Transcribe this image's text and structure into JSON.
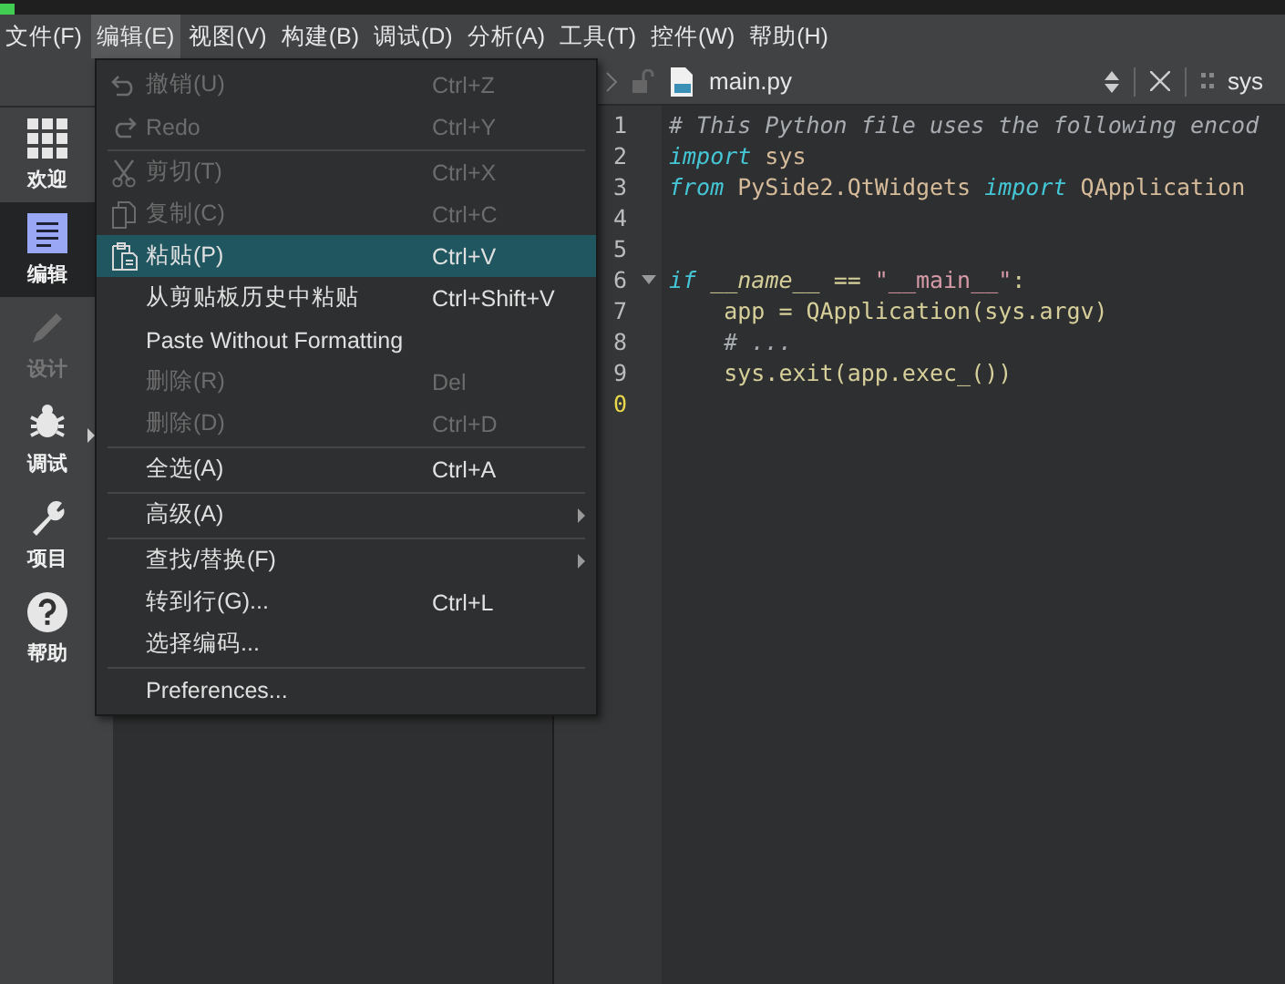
{
  "menubar": [
    {
      "label": "文件(F)",
      "selected": false
    },
    {
      "label": "编辑(E)",
      "selected": true
    },
    {
      "label": "视图(V)",
      "selected": false
    },
    {
      "label": "构建(B)",
      "selected": false
    },
    {
      "label": "调试(D)",
      "selected": false
    },
    {
      "label": "分析(A)",
      "selected": false
    },
    {
      "label": "工具(T)",
      "selected": false
    },
    {
      "label": "控件(W)",
      "selected": false
    },
    {
      "label": "帮助(H)",
      "selected": false
    }
  ],
  "modes": [
    {
      "label": "欢迎",
      "selected": false,
      "disabled": false,
      "has_arrow": false
    },
    {
      "label": "编辑",
      "selected": true,
      "disabled": false,
      "has_arrow": false
    },
    {
      "label": "设计",
      "selected": false,
      "disabled": true,
      "has_arrow": false
    },
    {
      "label": "调试",
      "selected": false,
      "disabled": false,
      "has_arrow": true
    },
    {
      "label": "项目",
      "selected": false,
      "disabled": false,
      "has_arrow": false
    },
    {
      "label": "帮助",
      "selected": false,
      "disabled": false,
      "has_arrow": false
    }
  ],
  "edit_menu": [
    {
      "kind": "item",
      "label": "撤销(U)",
      "shortcut": "Ctrl+Z",
      "disabled": true,
      "selected": false,
      "submenu": false
    },
    {
      "kind": "item",
      "label": "Redo",
      "shortcut": "Ctrl+Y",
      "disabled": true,
      "selected": false,
      "submenu": false
    },
    {
      "kind": "separator"
    },
    {
      "kind": "item",
      "label": "剪切(T)",
      "shortcut": "Ctrl+X",
      "disabled": true,
      "selected": false,
      "submenu": false
    },
    {
      "kind": "item",
      "label": "复制(C)",
      "shortcut": "Ctrl+C",
      "disabled": true,
      "selected": false,
      "submenu": false
    },
    {
      "kind": "item",
      "label": "粘贴(P)",
      "shortcut": "Ctrl+V",
      "disabled": false,
      "selected": true,
      "submenu": false
    },
    {
      "kind": "item",
      "label": "从剪贴板历史中粘贴",
      "shortcut": "Ctrl+Shift+V",
      "disabled": false,
      "selected": false,
      "submenu": false
    },
    {
      "kind": "item",
      "label": "Paste Without Formatting",
      "disabled": false,
      "selected": false,
      "submenu": false
    },
    {
      "kind": "item",
      "label": "删除(R)",
      "shortcut": "Del",
      "disabled": true,
      "selected": false,
      "submenu": false
    },
    {
      "kind": "item",
      "label": "删除(D)",
      "shortcut": "Ctrl+D",
      "disabled": true,
      "selected": false,
      "submenu": false
    },
    {
      "kind": "separator"
    },
    {
      "kind": "item",
      "label": "全选(A)",
      "shortcut": "Ctrl+A",
      "disabled": false,
      "selected": false,
      "submenu": false
    },
    {
      "kind": "separator"
    },
    {
      "kind": "item",
      "label": "高级(A)",
      "disabled": false,
      "selected": false,
      "submenu": true
    },
    {
      "kind": "separator"
    },
    {
      "kind": "item",
      "label": "查找/替换(F)",
      "disabled": false,
      "selected": false,
      "submenu": true
    },
    {
      "kind": "item",
      "label": "转到行(G)...",
      "shortcut": "Ctrl+L",
      "disabled": false,
      "selected": false,
      "submenu": false
    },
    {
      "kind": "item",
      "label": "选择编码...",
      "disabled": false,
      "selected": false,
      "submenu": false
    },
    {
      "kind": "separator"
    },
    {
      "kind": "item",
      "label": "Preferences...",
      "disabled": false,
      "selected": false,
      "submenu": false
    }
  ],
  "editor": {
    "file_name": "main.py",
    "symbol": "sys",
    "lines": [
      {
        "number": "1",
        "current": false,
        "fold": false,
        "tokens": [
          {
            "text": "# This Python file uses the following encod",
            "kind": "comment"
          }
        ]
      },
      {
        "number": "2",
        "current": false,
        "fold": false,
        "tokens": [
          {
            "text": "import",
            "kind": "keyword"
          },
          {
            "text": " sys",
            "kind": "name"
          }
        ]
      },
      {
        "number": "3",
        "current": false,
        "fold": false,
        "tokens": [
          {
            "text": "from",
            "kind": "keyword"
          },
          {
            "text": " PySide2.QtWidgets ",
            "kind": "name"
          },
          {
            "text": "import",
            "kind": "keyword"
          },
          {
            "text": " QApplication",
            "kind": "name"
          }
        ]
      },
      {
        "number": "4",
        "current": false,
        "fold": false
      },
      {
        "number": "5",
        "current": false,
        "fold": false
      },
      {
        "number": "6",
        "current": false,
        "fold": true,
        "tokens": [
          {
            "text": "if",
            "kind": "keyword"
          },
          {
            "text": " __name__",
            "kind": "dunder"
          },
          {
            "text": " == ",
            "kind": "plain"
          },
          {
            "text": "\"__main__\"",
            "kind": "string"
          },
          {
            "text": ":",
            "kind": "plain"
          }
        ]
      },
      {
        "number": "7",
        "current": false,
        "fold": false,
        "tokens": [
          {
            "text": "    app = QApplication(sys.argv)",
            "kind": "plain"
          }
        ]
      },
      {
        "number": "8",
        "current": false,
        "fold": false,
        "tokens": [
          {
            "text": "    # ...",
            "kind": "comment"
          }
        ]
      },
      {
        "number": "9",
        "current": false,
        "fold": false,
        "tokens": [
          {
            "text": "    sys.exit(app.exec_())",
            "kind": "plain"
          }
        ]
      },
      {
        "number": "0",
        "current": true,
        "fold": false
      }
    ]
  }
}
